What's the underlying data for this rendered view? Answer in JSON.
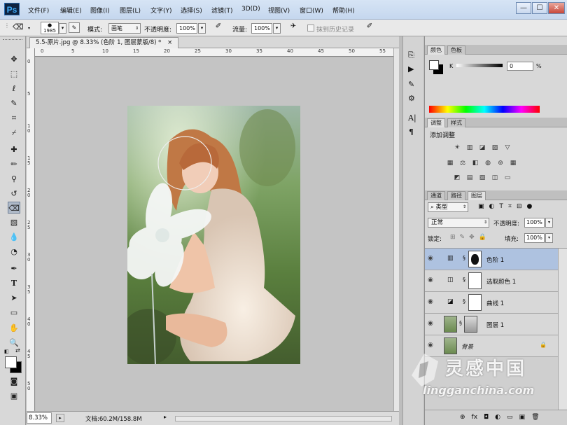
{
  "menubar": {
    "logo": "Ps",
    "items": [
      "文件(F)",
      "编辑(E)",
      "图像(I)",
      "图层(L)",
      "文字(Y)",
      "选择(S)",
      "滤镜(T)",
      "3D(D)",
      "视图(V)",
      "窗口(W)",
      "帮助(H)"
    ],
    "window_buttons": [
      "—",
      "☐",
      "✕"
    ]
  },
  "options": {
    "brush_size": "1985",
    "mode_label": "模式:",
    "mode_value": "画笔",
    "opacity_label": "不透明度:",
    "opacity_value": "100%",
    "flow_label": "流量:",
    "flow_value": "100%",
    "erase_history_label": "抹到历史记录"
  },
  "document": {
    "tab_title": "5.5-原片.jpg @ 8.33% (色阶 1, 图层蒙版/8) *",
    "tab_close": "×",
    "ruler_top": [
      "0",
      "5",
      "10",
      "15",
      "20",
      "25",
      "30",
      "35",
      "40",
      "45",
      "50",
      "55"
    ],
    "ruler_left": [
      "0",
      "5",
      "1 0",
      "1 5",
      "2 0",
      "2 5",
      "3 0",
      "3 5",
      "4 0",
      "4 5",
      "5 0"
    ],
    "zoom": "8.33%",
    "doc_size": "文档:60.2M/158.8M"
  },
  "color_panel": {
    "tabs": [
      "颜色",
      "色板"
    ],
    "channel_label": "K",
    "value": "0",
    "unit": "%"
  },
  "adjust_panel": {
    "tabs": [
      "调整",
      "样式"
    ],
    "heading": "添加调整",
    "row1": [
      "☀",
      "▥",
      "◪",
      "▨",
      "▽"
    ],
    "row2": [
      "▦",
      "⚖",
      "◧",
      "◍",
      "⊚",
      "▦"
    ],
    "row3": [
      "◩",
      "▤",
      "▧",
      "◫",
      "▭"
    ]
  },
  "layers_panel": {
    "tabs": [
      "通道",
      "路径",
      "图层"
    ],
    "filter_kind": "类型",
    "blend_mode": "正常",
    "opacity_label": "不透明度:",
    "opacity_value": "100%",
    "lock_label": "锁定:",
    "fill_label": "填充:",
    "fill_value": "100%",
    "layers": [
      {
        "name": "色阶 1"
      },
      {
        "name": "选取颜色 1"
      },
      {
        "name": "曲线 1"
      },
      {
        "name": "图层 1"
      },
      {
        "name": "背景"
      }
    ],
    "footer_icons": [
      "⊕",
      "fx",
      "◘",
      "◐",
      "▭",
      "▣",
      "🗑"
    ]
  },
  "watermark": {
    "title": "灵感中国",
    "url": "lingganchina.com"
  },
  "colors": {
    "menubar": "#c5d7ee",
    "selection": "#aec2e0",
    "gradient": [
      "#ff0000",
      "#ffff00",
      "#00ff00",
      "#00ffff",
      "#0000ff",
      "#ff00ff",
      "#ff0000"
    ]
  }
}
